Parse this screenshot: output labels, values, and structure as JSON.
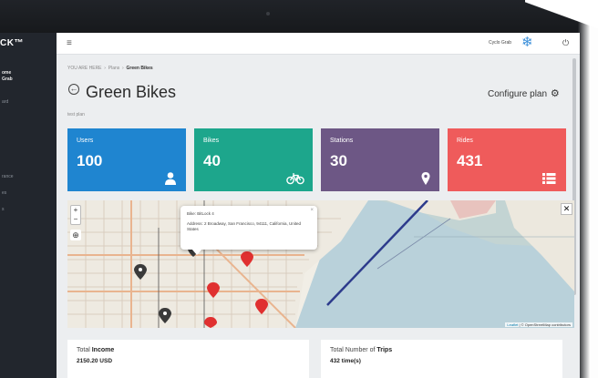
{
  "sidebar": {
    "brand": "CK™",
    "user_line1": "ome",
    "user_line2": "Grab",
    "items": [
      "ard",
      "rance",
      "es",
      "s"
    ]
  },
  "header": {
    "menu_icon": "hamburger-icon",
    "username": "Cyclo Grab",
    "logo_icon": "snowflake-logo-icon",
    "power_icon": "power-icon"
  },
  "breadcrumb": {
    "prefix": "YOU ARE HERE",
    "sep1": "›",
    "crumb1": "Plans",
    "sep2": "›",
    "current": "Green Bikes"
  },
  "page": {
    "title": "Green Bikes",
    "subtitle": "test plan",
    "configure_label": "Configure plan"
  },
  "stats": [
    {
      "label": "Users",
      "value": "100",
      "icon": "user-icon",
      "color": "#1f85d0"
    },
    {
      "label": "Bikes",
      "value": "40",
      "icon": "bicycle-icon",
      "color": "#1da68c"
    },
    {
      "label": "Stations",
      "value": "30",
      "icon": "map-pin-icon",
      "color": "#6d5785"
    },
    {
      "label": "Rides",
      "value": "431",
      "icon": "list-icon",
      "color": "#ef5b5b"
    }
  ],
  "map": {
    "zoom_in": "+",
    "zoom_out": "−",
    "close_icon": "✕",
    "popup": {
      "title": "Bike: BitLock 4",
      "address": "Address: 2 Broadway, San Francisco, 94111, California, United States",
      "close": "×"
    },
    "attribution_leaflet": "Leaflet",
    "attribution_rest": " | © OpenStreetMap contributors"
  },
  "panels": [
    {
      "label_prefix": "Total ",
      "label_bold": "Income",
      "value": "2150.20 USD"
    },
    {
      "label_prefix": "Total Number of ",
      "label_bold": "Trips",
      "value": "432 time(s)"
    }
  ]
}
